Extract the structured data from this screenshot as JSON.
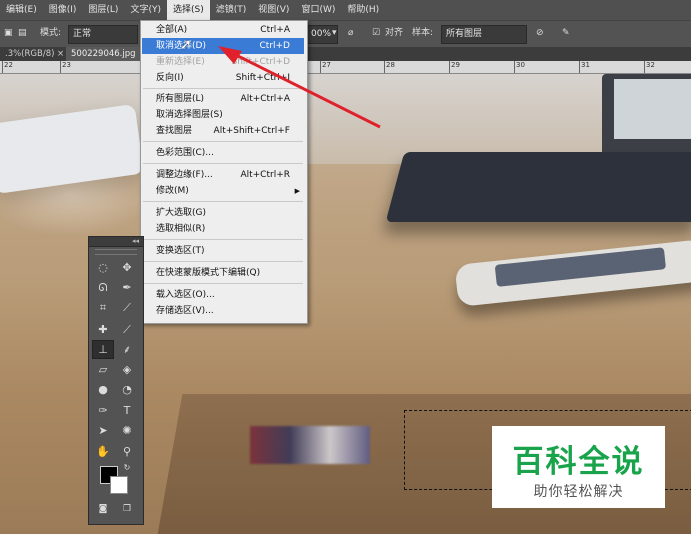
{
  "menubar": {
    "items": [
      "编辑(E)",
      "图像(I)",
      "图层(L)",
      "文字(Y)",
      "选择(S)",
      "滤镜(T)",
      "视图(V)",
      "窗口(W)",
      "帮助(H)"
    ],
    "active": "选择(S)"
  },
  "optionsbar": {
    "mode_label": "模式:",
    "mode_value": "正常",
    "opacity_value": "00%",
    "align_label": "对齐",
    "sample_label": "样本:",
    "sample_value": "所有图层"
  },
  "tabs": {
    "tab1": ".3%(RGB/8)",
    "tab2": "500229046.jpg"
  },
  "ruler": {
    "ticks": [
      "22",
      "23",
      "27",
      "28",
      "29",
      "30",
      "31",
      "32"
    ]
  },
  "select_menu": {
    "items": [
      {
        "label": "全部(A)",
        "shortcut": "Ctrl+A"
      },
      {
        "label": "取消选择(D)",
        "shortcut": "Ctrl+D"
      },
      {
        "label": "重新选择(E)",
        "shortcut": "Shift+Ctrl+D"
      },
      {
        "label": "反向(I)",
        "shortcut": "Shift+Ctrl+I"
      },
      {
        "label": "所有图层(L)",
        "shortcut": "Alt+Ctrl+A"
      },
      {
        "label": "取消选择图层(S)",
        "shortcut": ""
      },
      {
        "label": "查找图层",
        "shortcut": "Alt+Shift+Ctrl+F"
      },
      {
        "label": "色彩范围(C)...",
        "shortcut": ""
      },
      {
        "label": "调整边缘(F)...",
        "shortcut": "Alt+Ctrl+R"
      },
      {
        "label": "修改(M)",
        "shortcut": ""
      },
      {
        "label": "扩大选取(G)",
        "shortcut": ""
      },
      {
        "label": "选取相似(R)",
        "shortcut": ""
      },
      {
        "label": "变换选区(T)",
        "shortcut": ""
      },
      {
        "label": "在快速蒙版模式下编辑(Q)",
        "shortcut": ""
      },
      {
        "label": "载入选区(O)...",
        "shortcut": ""
      },
      {
        "label": "存储选区(V)...",
        "shortcut": ""
      }
    ],
    "highlighted": "取消选择(D)"
  },
  "toolbox": {
    "collapse_glyph": "◂◂",
    "tools": [
      "lasso-ellipse",
      "move",
      "lasso",
      "quick-select",
      "crop",
      "eyedropper",
      "healing",
      "brush",
      "clone-stamp",
      "history-brush",
      "eraser",
      "paint-bucket",
      "blur",
      "dodge",
      "pen",
      "type",
      "path-select",
      "shape",
      "hand",
      "zoom"
    ]
  },
  "watermark": {
    "title": "百科全说",
    "subtitle": "助你轻松解决"
  },
  "colors": {
    "highlight": "#3a7bd5",
    "arrow": "#e0202a",
    "watermark_green": "#19a34a"
  }
}
